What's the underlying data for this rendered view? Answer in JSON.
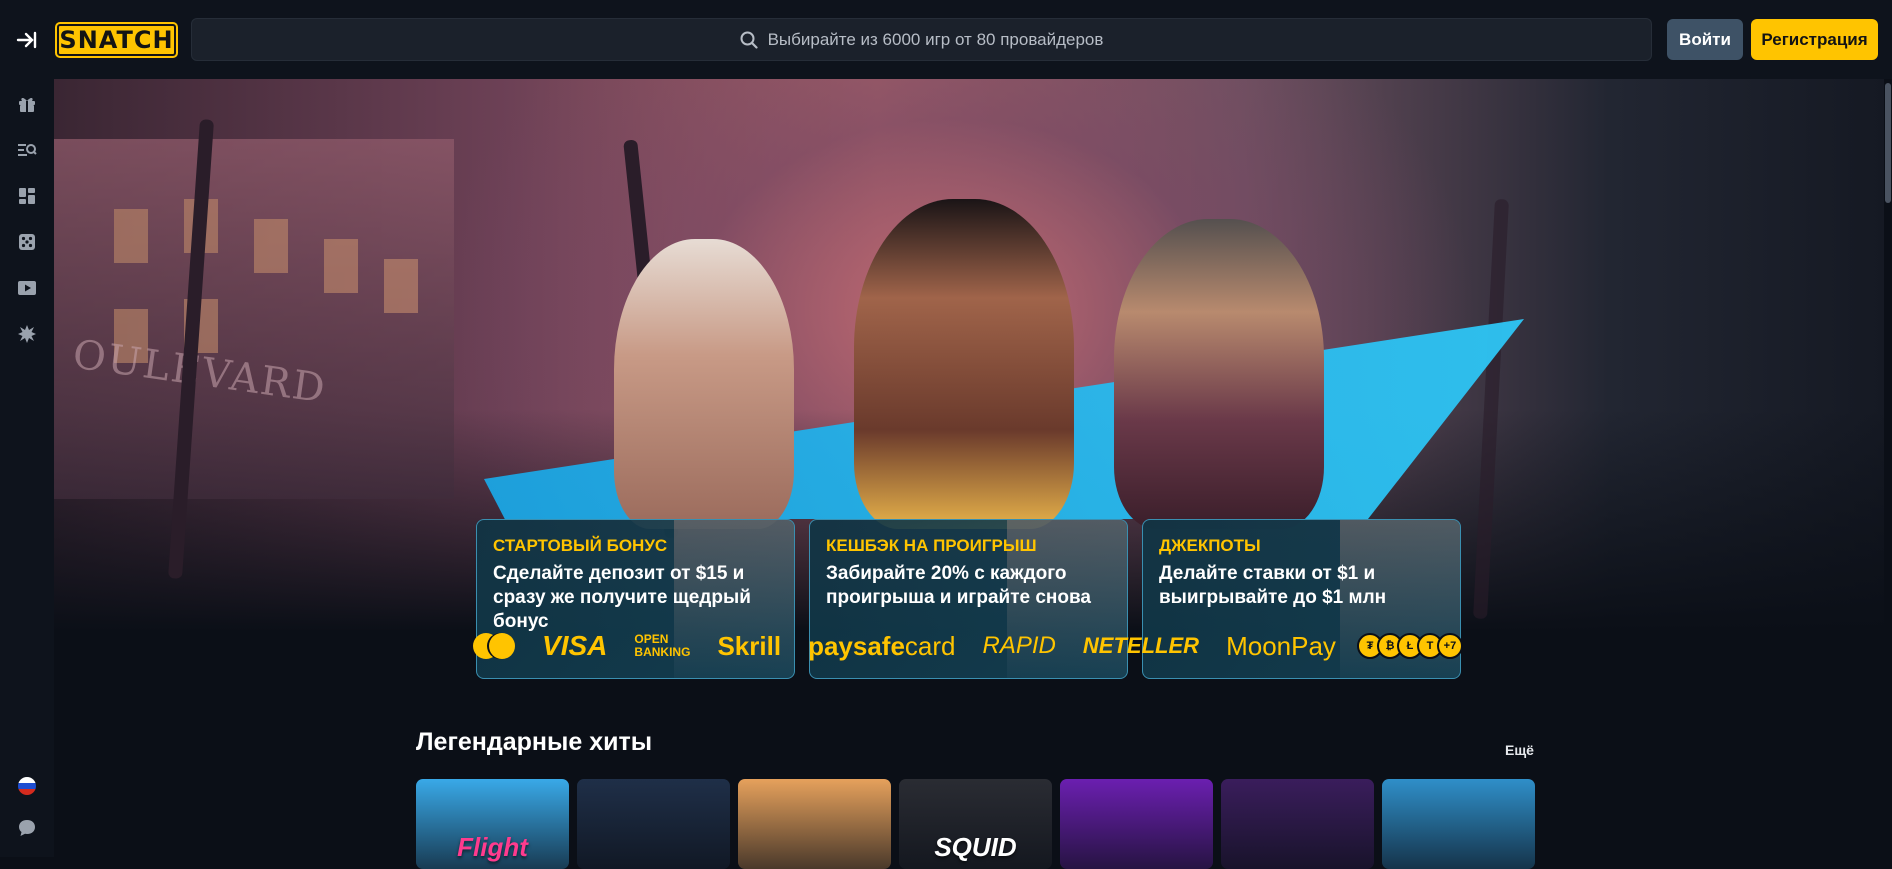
{
  "header": {
    "logo_text": "SNATCH",
    "search_placeholder": "Выбирайте из 6000 игр от 80 провайдеров",
    "login_label": "Войти",
    "register_label": "Регистрация"
  },
  "sidebar": {
    "items": [
      {
        "icon": "gift-icon"
      },
      {
        "icon": "search-list-icon"
      },
      {
        "icon": "grid-icon"
      },
      {
        "icon": "dice-icon"
      },
      {
        "icon": "live-play-icon"
      },
      {
        "icon": "starburst-icon"
      }
    ],
    "language_icon": "russian-flag-icon",
    "chat_icon": "chat-icon"
  },
  "hero": {
    "sign_text": "OULEVARD"
  },
  "promos": [
    {
      "title": "СТАРТОВЫЙ БОНУС",
      "text": "Сделайте депозит от $15 и сразу же получите щедрый бонус"
    },
    {
      "title": "КЕШБЭК НА ПРОИГРЫШ",
      "text": "Забирайте 20% с каждого проигрыша и играйте снова"
    },
    {
      "title": "ДЖЕКПОТЫ",
      "text": "Делайте ставки от $1 и выигрывайте до $1 млн"
    }
  ],
  "payments": {
    "visa": "VISA",
    "open_banking_1": "OPEN",
    "open_banking_2": "BANKING",
    "skrill": "Skrill",
    "paysafe_a": "paysafe",
    "paysafe_b": "card",
    "rapid": "RAPID",
    "neteller": "NETELLER",
    "moonpay": "MoonPay",
    "crypto_more": "+7"
  },
  "games_section": {
    "title": "Легендарные хиты",
    "more_label": "Ещё",
    "games": [
      {
        "title": "Flight",
        "bg": "#39a9e8",
        "color": "#ff3b8e"
      },
      {
        "title": "",
        "bg": "#1f2f48",
        "color": "#ffffff"
      },
      {
        "title": "",
        "bg": "#e6a15c",
        "color": "#ffffff"
      },
      {
        "title": "SQUID",
        "bg": "#2a2c33",
        "color": "#ffffff"
      },
      {
        "title": "",
        "bg": "#6b1fb0",
        "color": "#ffd51a"
      },
      {
        "title": "",
        "bg": "#3a1d5c",
        "color": "#ffffff"
      },
      {
        "title": "",
        "bg": "#2f8fc9",
        "color": "#ffffff"
      }
    ]
  }
}
